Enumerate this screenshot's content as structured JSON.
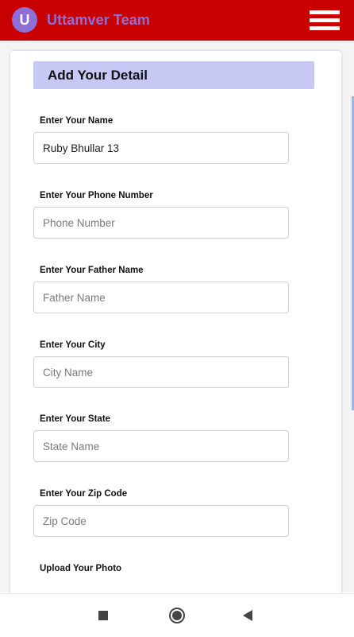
{
  "app": {
    "avatar_letter": "U",
    "title": "Uttamver Team",
    "menu_icon": "hamburger-menu-icon"
  },
  "form": {
    "header": "Add Your Detail",
    "fields": [
      {
        "label": "Enter Your Name",
        "value": "Ruby Bhullar 13",
        "placeholder": ""
      },
      {
        "label": "Enter Your Phone Number",
        "value": "",
        "placeholder": "Phone Number"
      },
      {
        "label": "Enter Your Father Name",
        "value": "",
        "placeholder": "Father Name"
      },
      {
        "label": "Enter Your City",
        "value": "",
        "placeholder": "City Name"
      },
      {
        "label": "Enter Your State",
        "value": "",
        "placeholder": "State Name"
      },
      {
        "label": "Enter Your Zip Code",
        "value": "",
        "placeholder": "Zip Code"
      }
    ],
    "upload_label": "Upload Your Photo"
  },
  "colors": {
    "topbar": "#c80000",
    "accent": "#8e6fd8",
    "section_header": "#c7c8f4"
  },
  "navbar": {
    "icons": [
      "square-recents-icon",
      "circle-home-icon",
      "triangle-back-icon"
    ]
  }
}
